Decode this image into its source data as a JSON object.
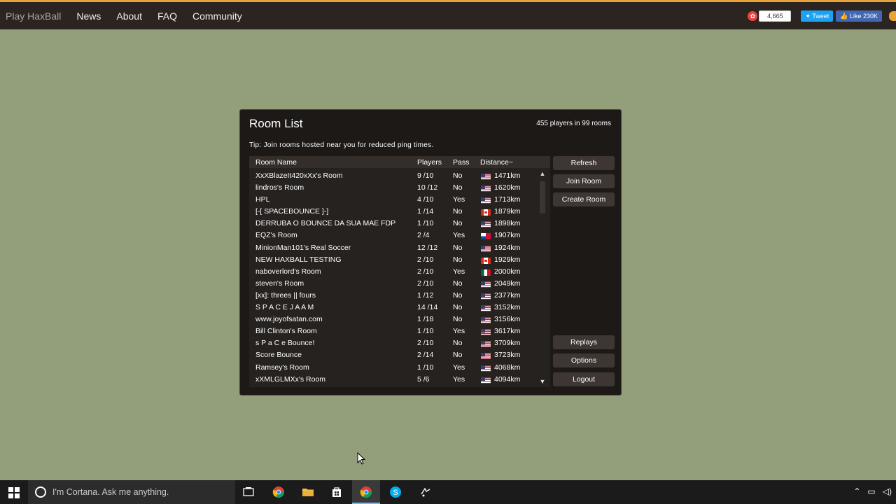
{
  "nav": {
    "brand": "Play HaxBall",
    "links": [
      "News",
      "About",
      "FAQ",
      "Community"
    ],
    "stumble_count": "4,665",
    "tweet_label": "Tweet",
    "like_label": "Like 230K"
  },
  "dialog": {
    "title": "Room List",
    "player_count": "455 players in 99 rooms",
    "tip": "Tip: Join rooms hosted near you for reduced ping times.",
    "columns": [
      "Room Name",
      "Players",
      "Pass",
      "Distance~"
    ],
    "rows": [
      {
        "name": "XxXBlazeIt420xXx's Room",
        "players": "9 /10",
        "pass": "No",
        "flag": "us",
        "distance": "1471km"
      },
      {
        "name": "lindros's Room",
        "players": "10 /12",
        "pass": "No",
        "flag": "us",
        "distance": "1620km"
      },
      {
        "name": "HPL",
        "players": "4 /10",
        "pass": "Yes",
        "flag": "us",
        "distance": "1713km"
      },
      {
        "name": "[-[   SPACEBOUNCE   ]-]",
        "players": "1 /14",
        "pass": "No",
        "flag": "ca",
        "distance": "1879km"
      },
      {
        "name": "DERRUBA O BOUNCE DA SUA MAE FDP",
        "players": "1 /10",
        "pass": "No",
        "flag": "us",
        "distance": "1898km"
      },
      {
        "name": "EQZ's Room",
        "players": "2 /4",
        "pass": "Yes",
        "flag": "pa",
        "distance": "1907km"
      },
      {
        "name": "MinionMan101's Real Soccer",
        "players": "12 /12",
        "pass": "No",
        "flag": "us",
        "distance": "1924km"
      },
      {
        "name": "NEW HAXBALL TESTING",
        "players": "2 /10",
        "pass": "No",
        "flag": "ca",
        "distance": "1929km"
      },
      {
        "name": "naboverlord's Room",
        "players": "2 /10",
        "pass": "Yes",
        "flag": "mx",
        "distance": "2000km"
      },
      {
        "name": "steven's Room",
        "players": "2 /10",
        "pass": "No",
        "flag": "us",
        "distance": "2049km"
      },
      {
        "name": "[xx]: threes || fours",
        "players": "1 /12",
        "pass": "No",
        "flag": "us",
        "distance": "2377km"
      },
      {
        "name": "S  P A C E J A A M",
        "players": "14 /14",
        "pass": "No",
        "flag": "us",
        "distance": "3152km"
      },
      {
        "name": "www.joyofsatan.com",
        "players": "1 /18",
        "pass": "No",
        "flag": "us",
        "distance": "3156km"
      },
      {
        "name": "Bill Clinton's Room",
        "players": "1 /10",
        "pass": "Yes",
        "flag": "us",
        "distance": "3617km"
      },
      {
        "name": "s P   a   C   e  Bounce!",
        "players": "2 /10",
        "pass": "No",
        "flag": "us",
        "distance": "3709km"
      },
      {
        "name": "Score Bounce",
        "players": "2 /14",
        "pass": "No",
        "flag": "us",
        "distance": "3723km"
      },
      {
        "name": "Ramsey's Room",
        "players": "1 /10",
        "pass": "Yes",
        "flag": "us",
        "distance": "4068km"
      },
      {
        "name": "xXMLGLMXx's Room",
        "players": "5 /6",
        "pass": "Yes",
        "flag": "us",
        "distance": "4094km"
      }
    ],
    "buttons": {
      "refresh": "Refresh",
      "join": "Join Room",
      "create": "Create Room",
      "replays": "Replays",
      "options": "Options",
      "logout": "Logout"
    }
  },
  "taskbar": {
    "search_placeholder": "I'm Cortana. Ask me anything."
  }
}
